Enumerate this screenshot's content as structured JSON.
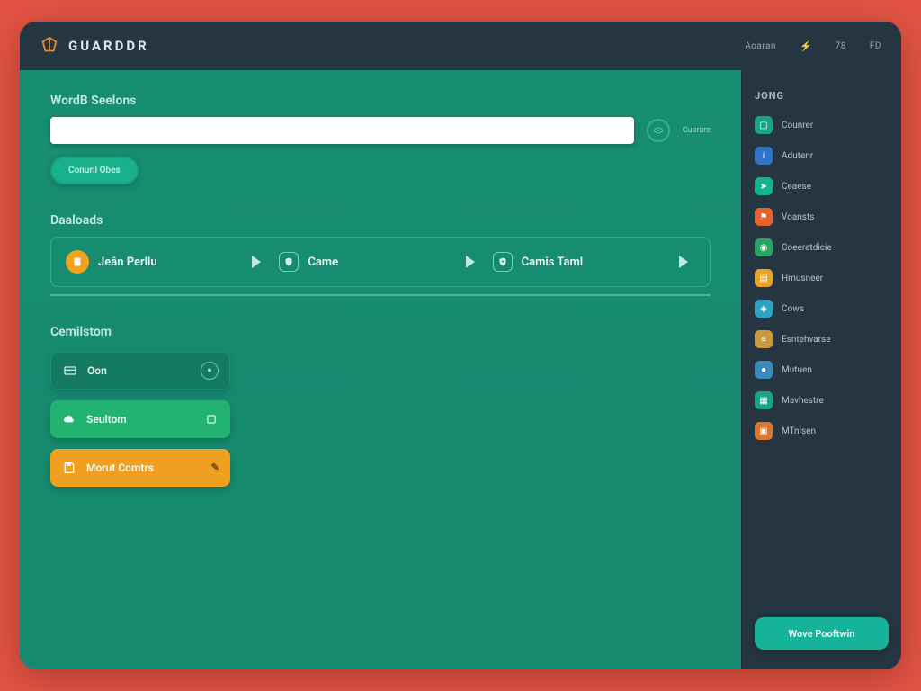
{
  "header": {
    "brand": "GUARDDR",
    "links": [
      "Aoaran",
      "78",
      "FD"
    ]
  },
  "search_section": {
    "title": "WordB Seelons",
    "value": "",
    "hint": "Cusrure",
    "button": "Conuril Obes"
  },
  "downloads": {
    "title": "Daaloads",
    "cards": [
      {
        "label": "Jeân Perllu"
      },
      {
        "label": "Came"
      },
      {
        "label": "Camis Taml"
      }
    ]
  },
  "cemilstom": {
    "title": "Cemilstom",
    "tiles": [
      {
        "label": "Oon"
      },
      {
        "label": "Seultom"
      },
      {
        "label": "Morut Comtrs"
      }
    ]
  },
  "sidebar": {
    "title": "JONG",
    "items": [
      {
        "label": "Counrer"
      },
      {
        "label": "Adutenr"
      },
      {
        "label": "Ceaese"
      },
      {
        "label": "Voansts"
      },
      {
        "label": "Coeeretdicie"
      },
      {
        "label": "Hmusneer"
      },
      {
        "label": "Cows"
      },
      {
        "label": "Esntehvarse"
      },
      {
        "label": "Mutuen"
      },
      {
        "label": "Mavhestre"
      },
      {
        "label": "MTnlsen"
      }
    ],
    "cta": "Wove Pooftwin"
  }
}
